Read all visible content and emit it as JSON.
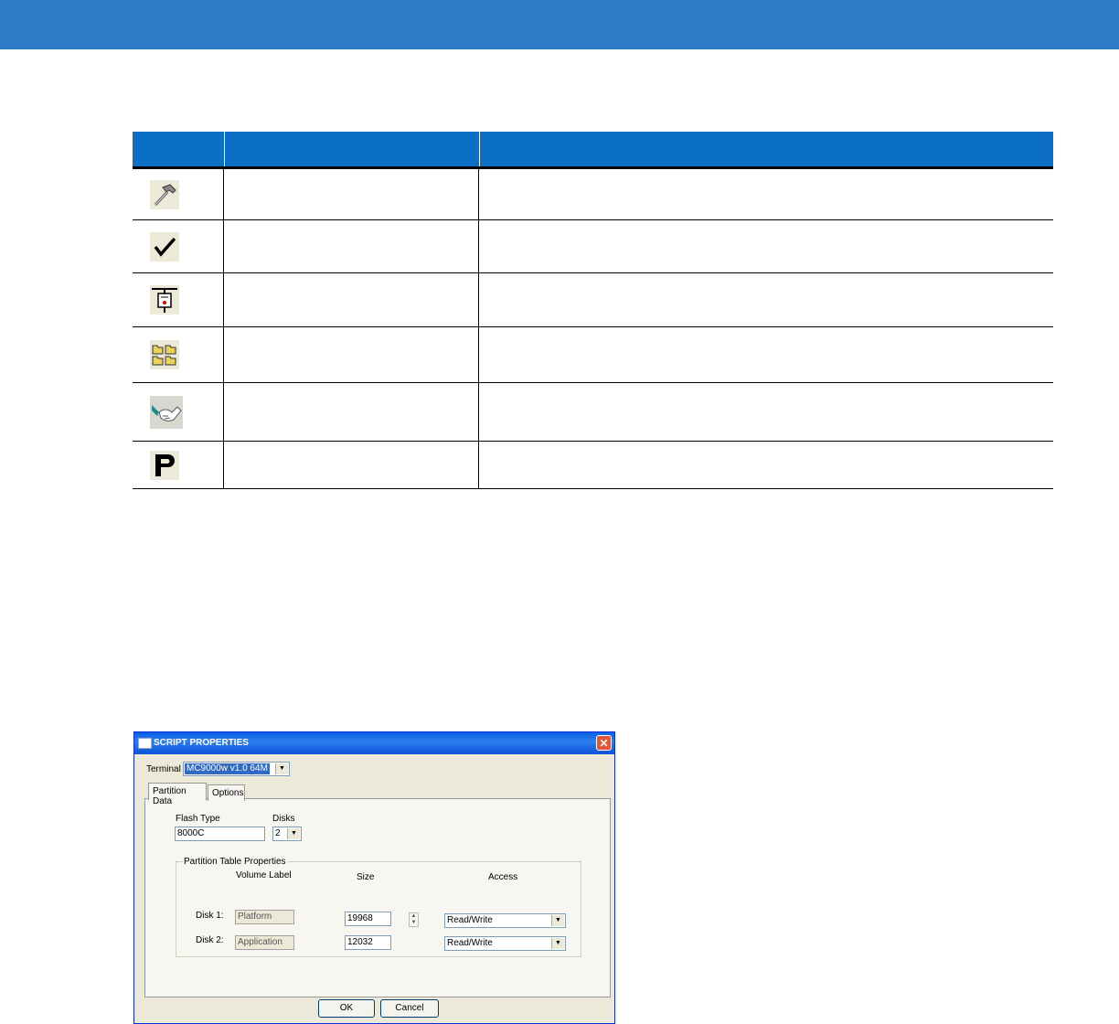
{
  "table": {
    "rows": [
      {
        "icon": "hammer-icon"
      },
      {
        "icon": "checkmark-icon"
      },
      {
        "icon": "plug-icon"
      },
      {
        "icon": "folders-icon"
      },
      {
        "icon": "handshake-icon"
      },
      {
        "icon": "letter-p-icon"
      }
    ]
  },
  "dialog": {
    "title": "SCRIPT PROPERTIES",
    "close_glyph": "✕",
    "terminal_label": "Terminal",
    "terminal_value": "MC9000w v1.0 64M",
    "tabs": [
      "Partition Data",
      "Options"
    ],
    "flash_type_label": "Flash Type",
    "flash_type_value": "8000C",
    "disks_label": "Disks",
    "disks_value": "2",
    "group_label": "Partition Table Properties",
    "col_volume": "Volume Label",
    "col_size": "Size",
    "col_access": "Access",
    "disk1_label": "Disk 1:",
    "disk1_volume": "Platform",
    "disk1_size": "19968",
    "disk1_access": "Read/Write",
    "disk2_label": "Disk 2:",
    "disk2_volume": "Application",
    "disk2_size": "12032",
    "disk2_access": "Read/Write",
    "ok": "OK",
    "cancel": "Cancel"
  }
}
